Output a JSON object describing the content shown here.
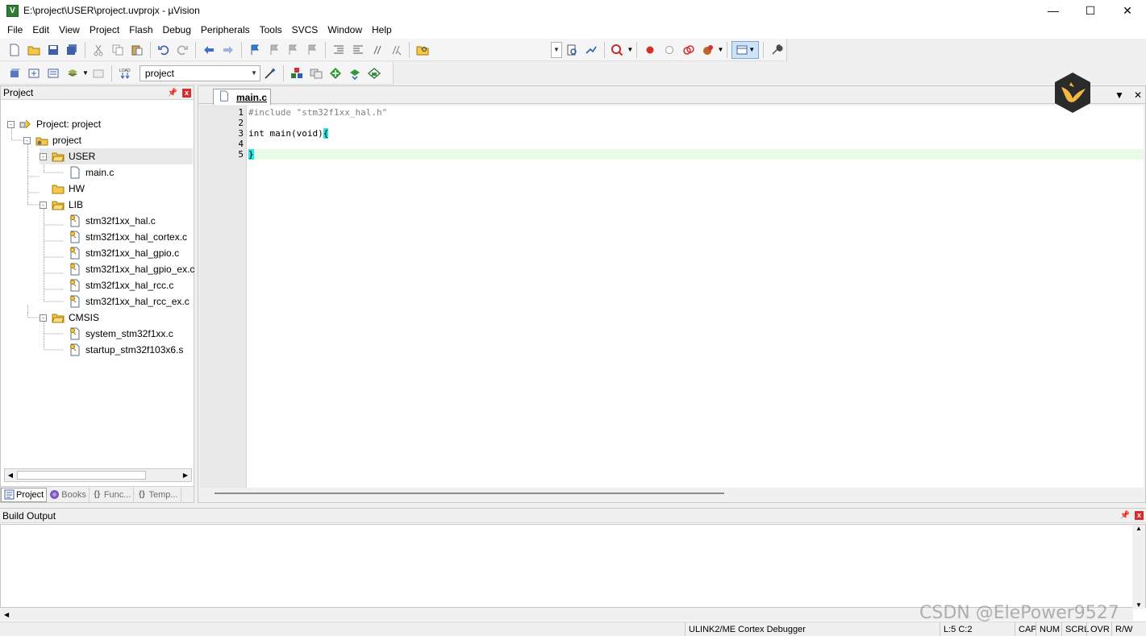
{
  "title": "E:\\project\\USER\\project.uvprojx - µVision",
  "app_icon_letter": "V",
  "window_controls": {
    "minimize": "—",
    "maximize": "☐",
    "close": "✕"
  },
  "menu": [
    "File",
    "Edit",
    "View",
    "Project",
    "Flash",
    "Debug",
    "Peripherals",
    "Tools",
    "SVCS",
    "Window",
    "Help"
  ],
  "target_combo": "project",
  "project_panel": {
    "title": "Project",
    "tree": [
      {
        "label": "Project: project",
        "level": 0,
        "type": "workspace",
        "expander": "-"
      },
      {
        "label": "project",
        "level": 1,
        "type": "target",
        "expander": "-"
      },
      {
        "label": "USER",
        "level": 2,
        "type": "folder",
        "expander": "-",
        "selected": true
      },
      {
        "label": "main.c",
        "level": 3,
        "type": "file"
      },
      {
        "label": "HW",
        "level": 2,
        "type": "folder"
      },
      {
        "label": "LIB",
        "level": 2,
        "type": "folder",
        "expander": "-"
      },
      {
        "label": "stm32f1xx_hal.c",
        "level": 3,
        "type": "file-key"
      },
      {
        "label": "stm32f1xx_hal_cortex.c",
        "level": 3,
        "type": "file-key"
      },
      {
        "label": "stm32f1xx_hal_gpio.c",
        "level": 3,
        "type": "file-key"
      },
      {
        "label": "stm32f1xx_hal_gpio_ex.c",
        "level": 3,
        "type": "file-key"
      },
      {
        "label": "stm32f1xx_hal_rcc.c",
        "level": 3,
        "type": "file-key"
      },
      {
        "label": "stm32f1xx_hal_rcc_ex.c",
        "level": 3,
        "type": "file-key"
      },
      {
        "label": "CMSIS",
        "level": 2,
        "type": "folder",
        "expander": "-"
      },
      {
        "label": "system_stm32f1xx.c",
        "level": 3,
        "type": "file-key"
      },
      {
        "label": "startup_stm32f103x6.s",
        "level": 3,
        "type": "file-key"
      }
    ],
    "tabs": [
      {
        "label": "Project",
        "icon": "project-icon",
        "active": true
      },
      {
        "label": "Books",
        "icon": "books-icon"
      },
      {
        "label": "Func...",
        "icon": "braces-icon"
      },
      {
        "label": "Temp...",
        "icon": "template-icon"
      }
    ]
  },
  "editor": {
    "tab": "main.c",
    "lines": [
      {
        "num": "1",
        "text": "#include \"stm32f1xx_hal.h\""
      },
      {
        "num": "2",
        "text": ""
      },
      {
        "num": "3",
        "text": "int main(void)",
        "brace": "{"
      },
      {
        "num": "4",
        "text": ""
      },
      {
        "num": "5",
        "text": "",
        "brace": "}"
      }
    ]
  },
  "build_output": {
    "title": "Build Output"
  },
  "status": {
    "debugger": "ULINK2/ME Cortex Debugger",
    "position": "L:5 C:2",
    "caps": "CAP",
    "num": "NUM",
    "scrl": "SCRL",
    "ovr": "OVR",
    "rw": "R/W"
  },
  "watermark": "CSDN @ElePower9527",
  "colors": {
    "accent_green": "#2e7d32",
    "close_red": "#d32f2f",
    "brace_highlight": "#28e6e6",
    "current_line": "#e8fbe8"
  }
}
